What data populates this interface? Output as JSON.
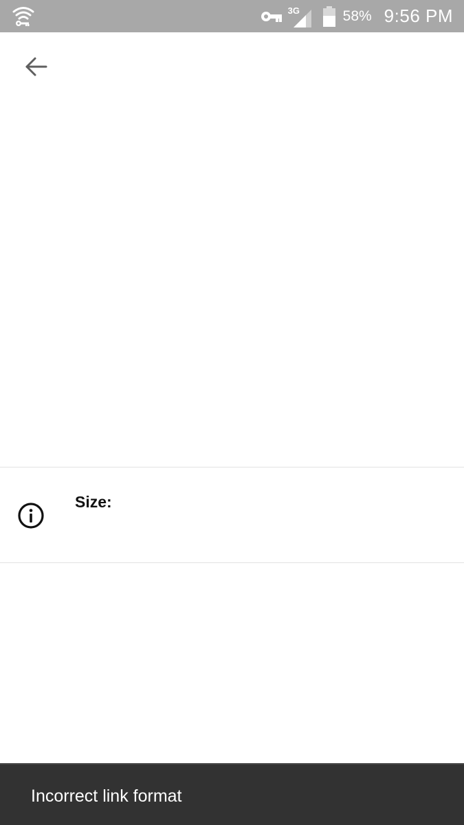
{
  "status_bar": {
    "network_label": "3G",
    "battery_percent": "58%",
    "time": "9:56 PM",
    "icons": [
      "wifi-key-icon",
      "vpn-key-icon",
      "cell-signal-icon",
      "battery-icon"
    ],
    "background_color": "#a8a8a8"
  },
  "toolbar": {
    "back_icon": "arrow-left-icon"
  },
  "info_row": {
    "icon": "info-circle-icon",
    "size_label": "Size:"
  },
  "snackbar": {
    "message": "Incorrect link format",
    "background_color": "#323232"
  }
}
